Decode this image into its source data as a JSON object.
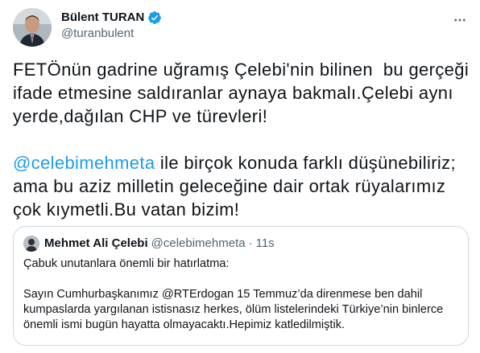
{
  "tweet": {
    "author_name": "Bülent TURAN",
    "author_handle": "@turanbulent",
    "verified_icon": "verified-badge-icon",
    "more_icon": "more-horizontal-icon",
    "text_line1": "FETÖnün gadrine uğramış Çelebi'nin bilinen  bu gerçeği\nifade etmesine saldıranlar aynaya bakmalı.Çelebi aynı\nyerde,dağılan CHP ve türevleri!\n\n",
    "mention": "@celebimehmeta",
    "text_line2": " ile birçok konuda farklı düşünebiliriz;\nama bu aziz milletin geleceğine dair ortak rüyalarımız\nçok kıymetli.Bu vatan bizim!"
  },
  "quote": {
    "author_name": "Mehmet Ali Çelebi",
    "author_handle": "@celebimehmeta",
    "separator": "·",
    "time": "11s",
    "text": "Çabuk unutanlara önemli bir hatırlatma:\n\nSayın Cumhurbaşkanımız @RTErdogan 15 Temmuz’da direnmese ben dahil\nkumpaslarda yargılanan istisnasız herkes, ölüm listelerindeki Türkiye’nin binlerce\nönemli ismi bugün hayatta olmayacaktı.Hepimiz katledilmiştik."
  },
  "colors": {
    "link": "#1d9bf0",
    "text": "#0f1419",
    "secondary": "#536471",
    "border": "#cfd9de"
  }
}
